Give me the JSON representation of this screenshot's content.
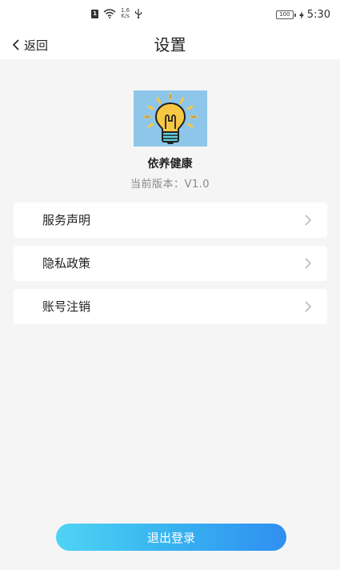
{
  "status_bar": {
    "sim_badge": "1",
    "net_speed_value": "1.6",
    "net_speed_unit": "K/s",
    "battery_level": "100",
    "time": "5:30"
  },
  "header": {
    "back_label": "返回",
    "title": "设置"
  },
  "app": {
    "logo_icon": "lightbulb-icon",
    "name": "依养健康",
    "version": "当前版本：V1.0"
  },
  "menu": {
    "items": [
      {
        "label": "服务声明"
      },
      {
        "label": "隐私政策"
      },
      {
        "label": "账号注销"
      }
    ]
  },
  "logout": {
    "label": "退出登录"
  },
  "colors": {
    "background": "#f5f5f6",
    "logo_bg": "#8ec6ea",
    "bulb_yellow": "#f7c744",
    "bulb_base": "#5fd3e0",
    "button_gradient_start": "#4fd4f4",
    "button_gradient_end": "#2f8ff0"
  }
}
